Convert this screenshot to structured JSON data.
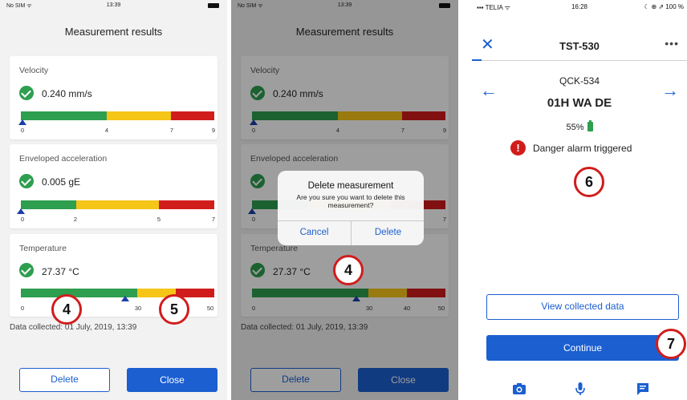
{
  "panel_left": {
    "status": {
      "carrier": "No SIM ᯤ",
      "time": "13:39"
    },
    "title": "Measurement results",
    "cards": [
      {
        "label": "Velocity",
        "value": "0.240 mm/s",
        "ticks": [
          "0",
          "4",
          "7",
          "9"
        ]
      },
      {
        "label": "Enveloped acceleration",
        "value": "0.005 gE",
        "ticks": [
          "0",
          "2",
          "5",
          "7"
        ]
      },
      {
        "label": "Temperature",
        "value": "27.37 °C",
        "ticks": [
          "0",
          "30",
          "50"
        ]
      }
    ],
    "collected": "Data collected: 01 July, 2019, 13:39",
    "delete_label": "Delete",
    "close_label": "Close",
    "callouts": [
      "4",
      "5"
    ]
  },
  "panel_middle": {
    "status": {
      "carrier": "No SIM ᯤ",
      "time": "13:39"
    },
    "title": "Measurement results",
    "cards": [
      {
        "label": "Velocity",
        "value": "0.240 mm/s",
        "ticks": [
          "0",
          "4",
          "7",
          "9"
        ]
      },
      {
        "label": "Enveloped acceleration",
        "ticks": [
          "0",
          "7"
        ]
      },
      {
        "label": "Temperature",
        "value": "27.37 °C",
        "ticks": [
          "0",
          "30",
          "40",
          "50"
        ]
      }
    ],
    "dialog": {
      "title": "Delete measurement",
      "message": "Are you sure you want to delete this measurement?",
      "cancel": "Cancel",
      "delete": "Delete"
    },
    "collected": "Data collected: 01 July, 2019, 13:39",
    "delete_label": "Delete",
    "close_label": "Close",
    "callout": "4"
  },
  "panel_right": {
    "status": {
      "carrier": "▪▪▪ TELIA ᯤ",
      "time": "16:28",
      "right": "☾ ⊕ ⇗ 100 %"
    },
    "header_title": "TST-530",
    "more": "•••",
    "asset_code": "QCK-534",
    "asset_name": "01H WA DE",
    "battery": "55%",
    "alarm_text": "Danger alarm triggered",
    "view_label": "View collected data",
    "continue_label": "Continue",
    "callouts": [
      "6",
      "7"
    ]
  },
  "colors": {
    "green": "#2e9e4f",
    "yellow": "#f5c518",
    "red": "#d11c1c",
    "blue": "#1b5fd0"
  },
  "icons": [
    "check-icon",
    "close-icon",
    "more-icon",
    "arrow-left-icon",
    "arrow-right-icon",
    "battery-icon",
    "alert-icon",
    "camera-icon",
    "microphone-icon",
    "message-icon"
  ]
}
